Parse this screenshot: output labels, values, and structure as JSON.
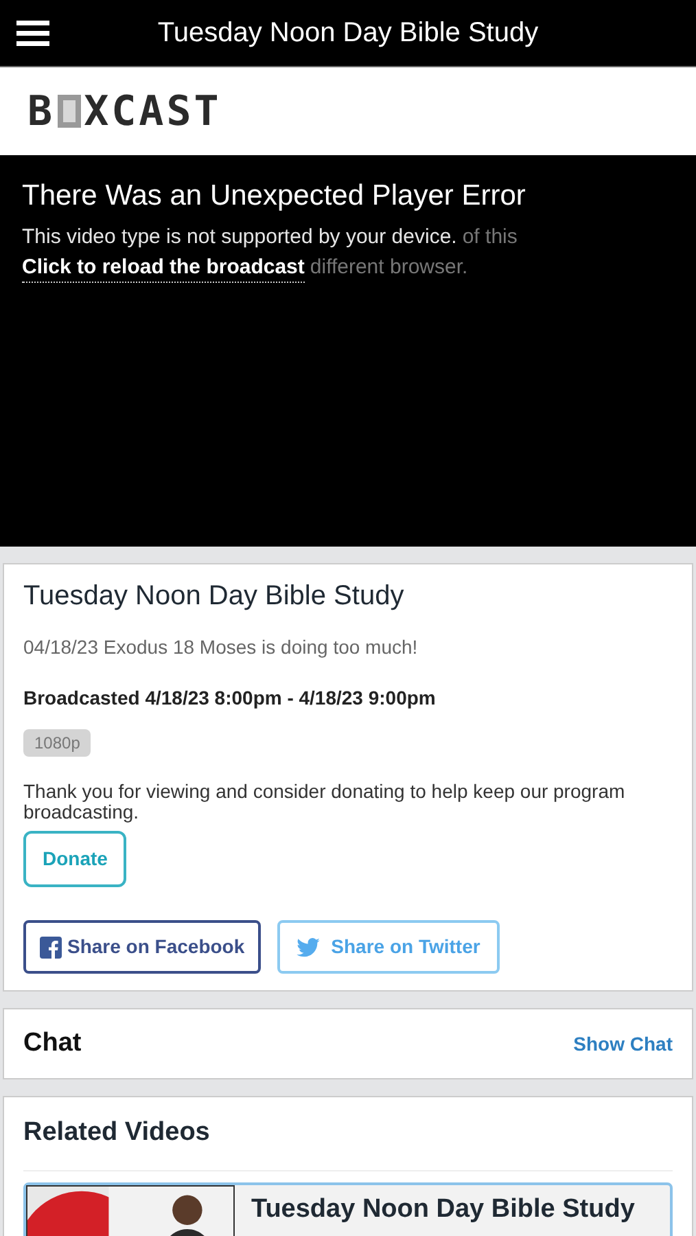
{
  "header": {
    "title": "Tuesday Noon Day Bible Study"
  },
  "logo": {
    "before": "B",
    "after": "XCAST"
  },
  "player": {
    "error_title": "There Was an Unexpected Player Error",
    "message": "This video type is not supported by your device.",
    "message_behind": "of this",
    "reload_link": "Click to reload the broadcast",
    "reload_behind": "different browser."
  },
  "details": {
    "title": "Tuesday Noon Day Bible Study",
    "description": "04/18/23 Exodus 18 Moses is doing too much!",
    "broadcast_time": "Broadcasted 4/18/23 8:00pm - 4/18/23 9:00pm",
    "quality_badge": "1080p",
    "donate_text": "Thank you for viewing and consider donating to help keep our program broadcasting.",
    "donate_button": "Donate",
    "share_buttons": [
      {
        "kind": "facebook",
        "label": "Share on Facebook"
      },
      {
        "kind": "twitter",
        "label": "Share on Twitter"
      }
    ]
  },
  "chat": {
    "title": "Chat",
    "toggle": "Show Chat"
  },
  "related": {
    "title": "Related Videos",
    "videos": [
      {
        "title": "Tuesday Noon Day Bible Study"
      }
    ]
  }
}
